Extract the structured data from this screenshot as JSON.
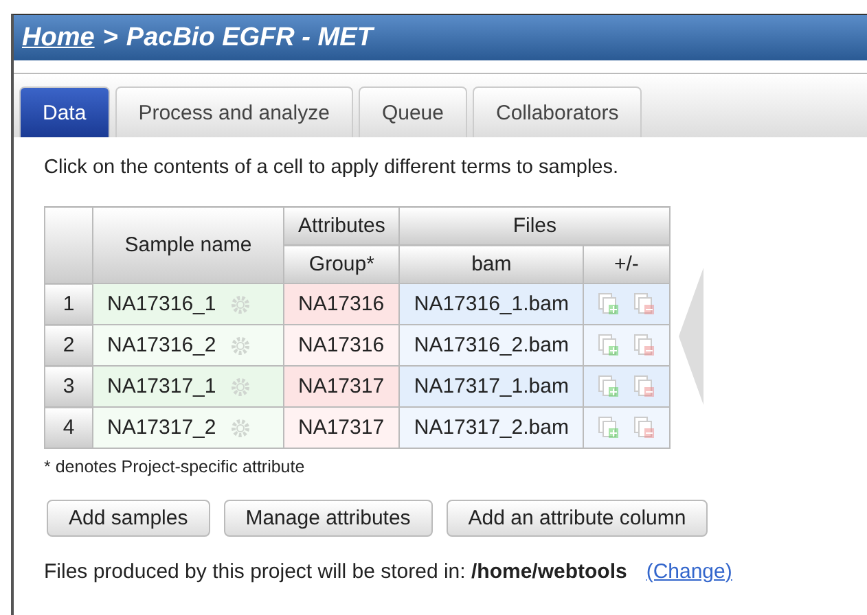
{
  "breadcrumb": {
    "home": "Home",
    "separator": ">",
    "title": "PacBio EGFR - MET"
  },
  "tabs": [
    {
      "label": "Data",
      "selected": true
    },
    {
      "label": "Process and analyze",
      "selected": false
    },
    {
      "label": "Queue",
      "selected": false
    },
    {
      "label": "Collaborators",
      "selected": false
    }
  ],
  "instruction": "Click on the contents of a cell to apply different terms to samples.",
  "table": {
    "groups": {
      "sample": "Sample name",
      "attributes": "Attributes",
      "files": "Files"
    },
    "columns": {
      "group": "Group*",
      "bam": "bam",
      "add_remove": "+/-"
    },
    "rows": [
      {
        "index": "1",
        "sample": "NA17316_1",
        "group": "NA17316",
        "bam": "NA17316_1.bam"
      },
      {
        "index": "2",
        "sample": "NA17316_2",
        "group": "NA17316",
        "bam": "NA17316_2.bam"
      },
      {
        "index": "3",
        "sample": "NA17317_1",
        "group": "NA17317",
        "bam": "NA17317_1.bam"
      },
      {
        "index": "4",
        "sample": "NA17317_2",
        "group": "NA17317",
        "bam": "NA17317_2.bam"
      }
    ]
  },
  "footnote": "* denotes Project-specific attribute",
  "buttons": [
    "Add samples",
    "Manage attributes",
    "Add an attribute column"
  ],
  "storage": {
    "text": "Files produced by this project will be stored in: **/home/webtools**",
    "link": "(Change)"
  }
}
